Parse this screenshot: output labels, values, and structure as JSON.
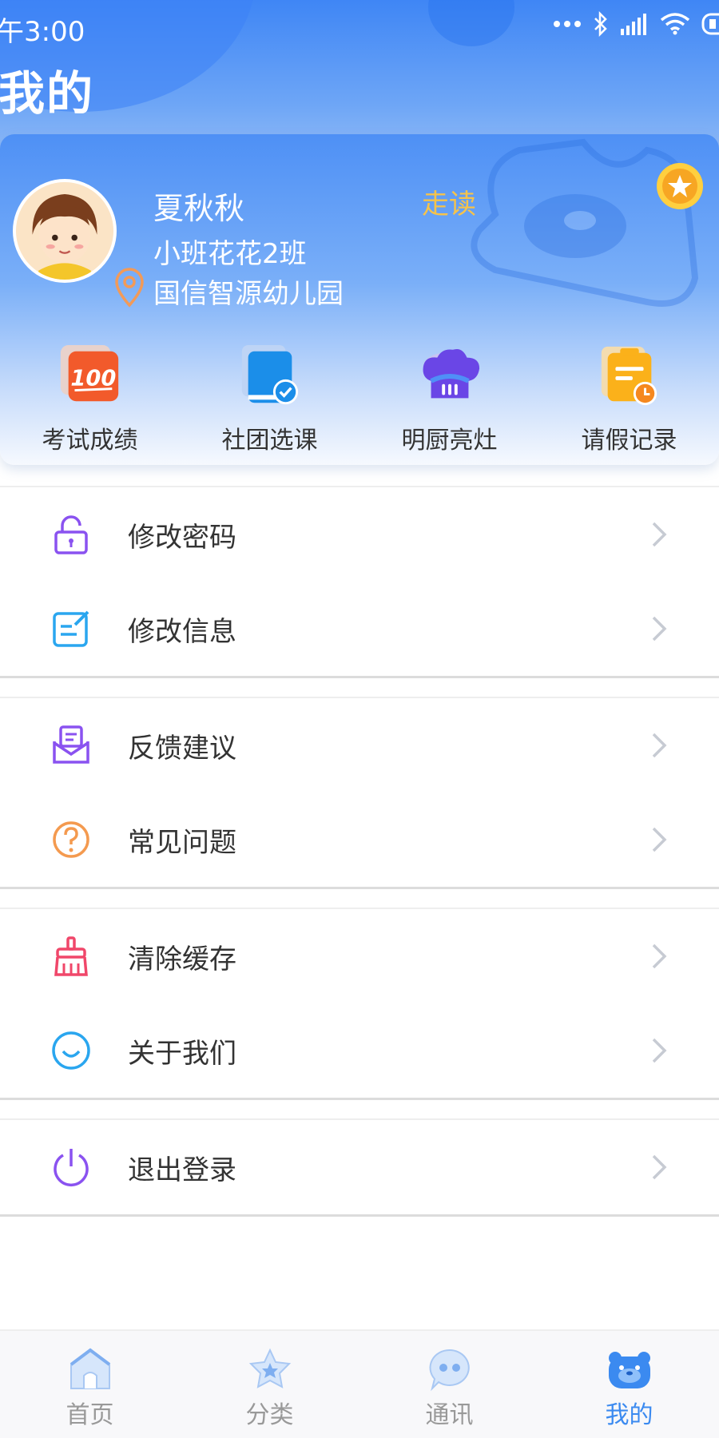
{
  "status_bar": {
    "time": "午3:00"
  },
  "header": {
    "title": "我的"
  },
  "profile": {
    "name": "夏秋秋",
    "class": "小班花花2班",
    "school": "国信智源幼儿园",
    "reading_type": "走读"
  },
  "quick_actions": [
    {
      "label": "考试成绩",
      "icon": "exam-score-icon"
    },
    {
      "label": "社团选课",
      "icon": "club-course-icon"
    },
    {
      "label": "明厨亮灶",
      "icon": "chef-hat-icon"
    },
    {
      "label": "请假记录",
      "icon": "leave-record-icon"
    }
  ],
  "menu": {
    "change_password": "修改密码",
    "edit_info": "修改信息",
    "feedback": "反馈建议",
    "faq": "常见问题",
    "clear_cache": "清除缓存",
    "about_us": "关于我们",
    "logout": "退出登录"
  },
  "tabs": [
    {
      "label": "首页",
      "icon": "home-icon"
    },
    {
      "label": "分类",
      "icon": "star-category-icon"
    },
    {
      "label": "通讯",
      "icon": "chat-icon"
    },
    {
      "label": "我的",
      "icon": "bear-profile-icon"
    }
  ],
  "colors": {
    "accent": "#3b8af0",
    "reading_type": "#f5c34b",
    "tab_inactive": "#999999"
  }
}
